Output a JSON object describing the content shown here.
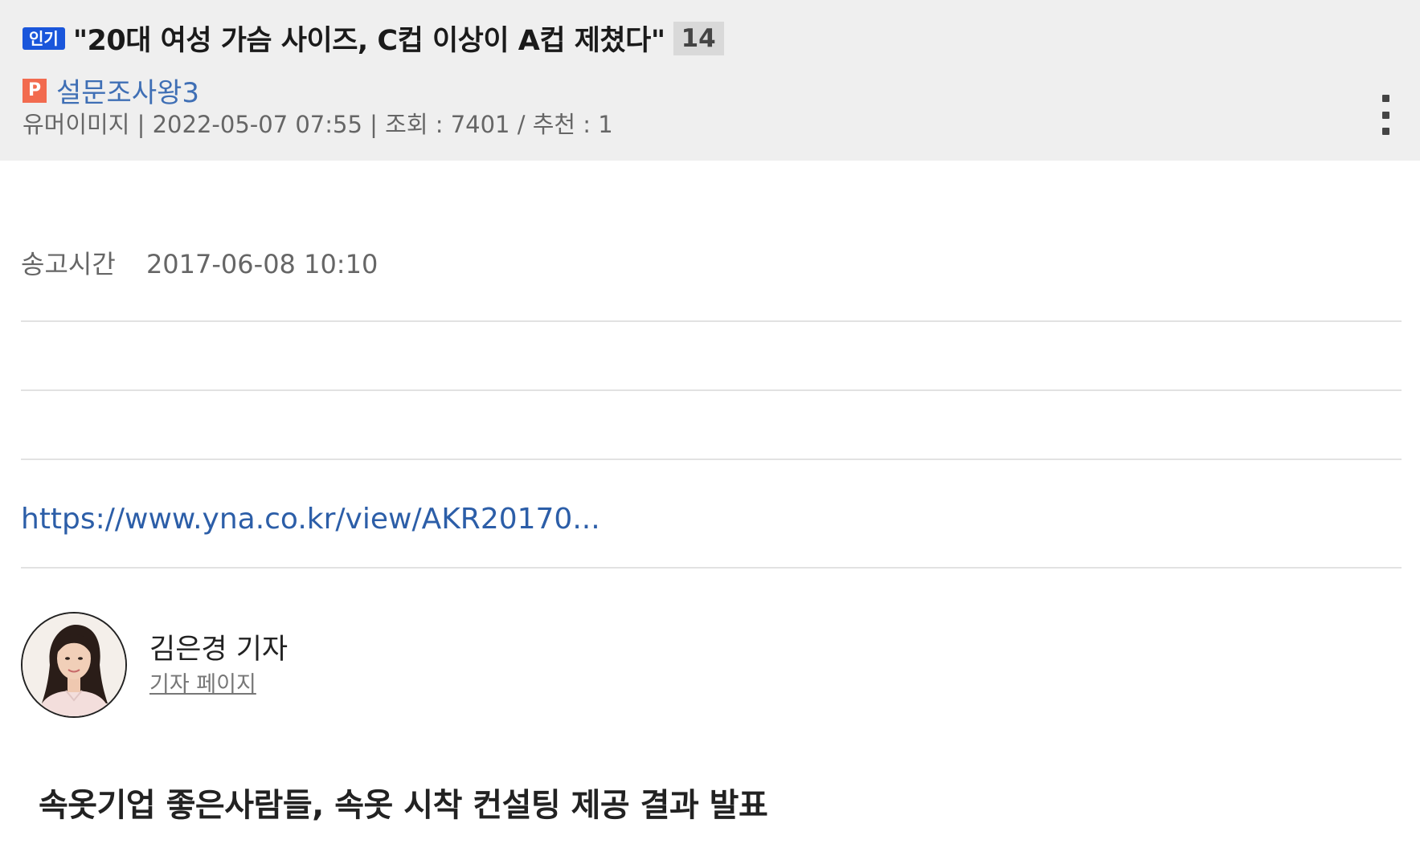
{
  "header": {
    "badge": "인기",
    "title": "\"20대 여성 가슴 사이즈, C컵 이상이 A컵 제쳤다\"",
    "comment_count": "14",
    "author_icon": "P",
    "author": "설문조사왕3",
    "meta": "유머이미지 | 2022-05-07 07:55 | 조회 : 7401 / 추천 : 1",
    "more_icon": "more-vertical-icon"
  },
  "article": {
    "send_time_label": "송고시간",
    "send_time_value": "2017-06-08 10:10",
    "link_text": "https://www.yna.co.kr/view/AKR20170...",
    "reporter_name": "김은경 기자",
    "reporter_page_label": "기자 페이지",
    "headline": "속옷기업 좋은사람들, 속옷 시착 컨설팅 제공 결과 발표"
  },
  "colors": {
    "header_bg": "#efefef",
    "badge_bg": "#1a56db",
    "author_link": "#3f6fb5",
    "url_link": "#2c5ea8",
    "p_icon_bg": "#f26b4f"
  }
}
